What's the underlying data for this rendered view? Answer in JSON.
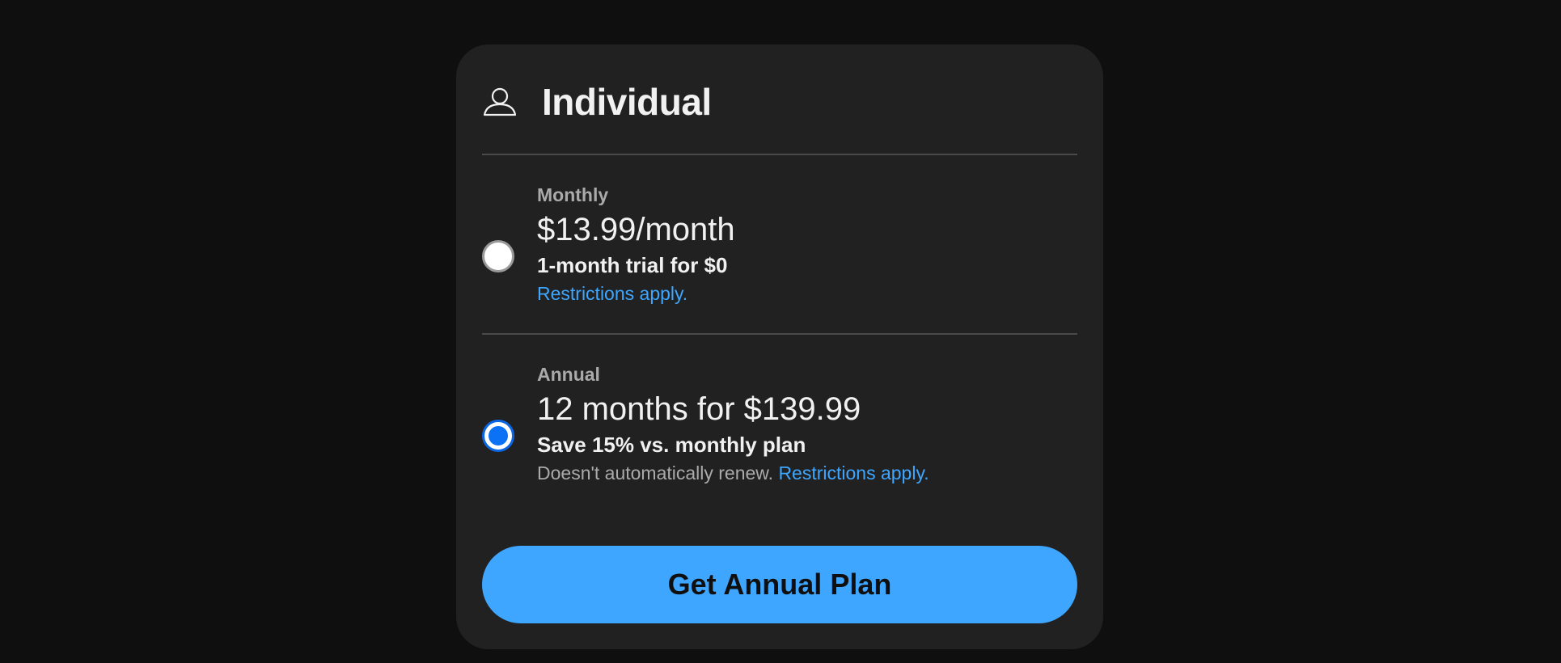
{
  "header": {
    "icon": "person-icon",
    "title": "Individual"
  },
  "plans": [
    {
      "name": "Monthly",
      "price": "$13.99/month",
      "note": "1-month trial for $0",
      "fine_print": "",
      "link": "Restrictions apply.",
      "selected": false
    },
    {
      "name": "Annual",
      "price": "12 months for $139.99",
      "note": "Save 15% vs. monthly plan",
      "fine_print": "Doesn't automatically renew. ",
      "link": "Restrictions apply.",
      "selected": true
    }
  ],
  "cta": {
    "label": "Get Annual Plan"
  },
  "colors": {
    "background": "#0f0f0f",
    "card": "#212121",
    "accent": "#3ea6ff",
    "radio_selected": "#0b72f5"
  }
}
